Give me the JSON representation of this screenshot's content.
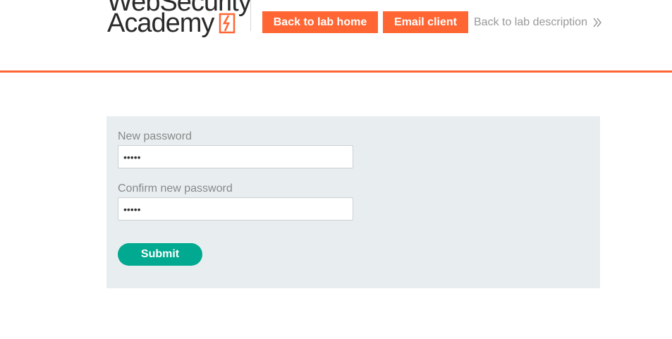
{
  "header": {
    "logo": {
      "line1": "WebSecurity",
      "line2": "Academy"
    },
    "buttons": {
      "lab_home": "Back to lab home",
      "email_client": "Email client"
    },
    "description_link": "Back to lab description",
    "colors": {
      "accent": "#ff6633",
      "link_grey": "#999999"
    }
  },
  "form": {
    "new_password_label": "New password",
    "new_password_value": "•••••",
    "confirm_password_label": "Confirm new password",
    "confirm_password_value": "•••••",
    "submit_label": "Submit",
    "colors": {
      "panel_background": "#e8eef0",
      "submit_background": "#00a98f"
    }
  }
}
